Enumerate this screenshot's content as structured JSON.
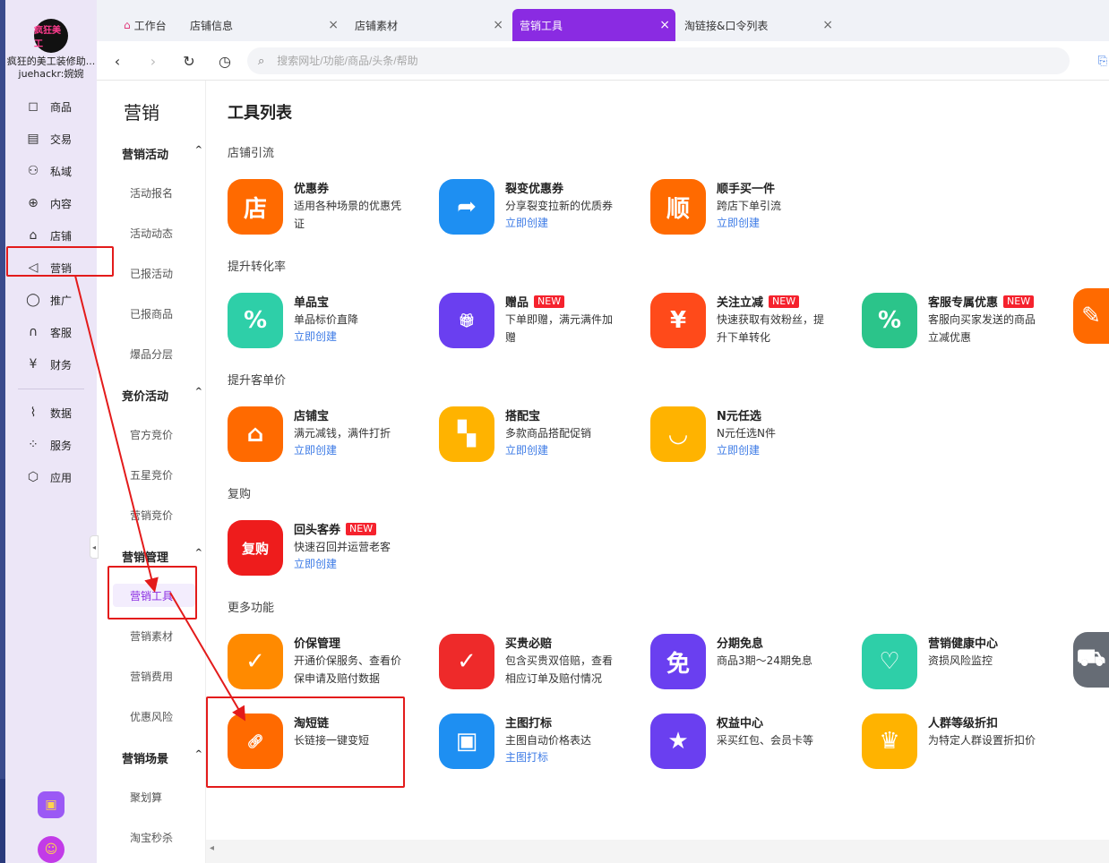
{
  "shop": {
    "logo_text": "疯狂美工",
    "name": "疯狂的美工装修助...",
    "user": "juehackr:婉婉"
  },
  "rail": [
    {
      "label": "商品",
      "icon": "goods-icon",
      "glyph": "◻"
    },
    {
      "label": "交易",
      "icon": "trade-icon",
      "glyph": "▤"
    },
    {
      "label": "私域",
      "icon": "private-domain-icon",
      "glyph": "⚇"
    },
    {
      "label": "内容",
      "icon": "content-icon",
      "glyph": "⊕"
    },
    {
      "label": "店铺",
      "icon": "store-icon",
      "glyph": "⌂"
    },
    {
      "label": "营销",
      "icon": "megaphone-icon",
      "glyph": "◁"
    },
    {
      "label": "推广",
      "icon": "bulb-icon",
      "glyph": "◯"
    },
    {
      "label": "客服",
      "icon": "headset-icon",
      "glyph": "∩"
    },
    {
      "label": "财务",
      "icon": "yuan-icon",
      "glyph": "¥"
    },
    {
      "label": "数据",
      "icon": "chart-icon",
      "glyph": "⌇"
    },
    {
      "label": "服务",
      "icon": "grid-icon",
      "glyph": "⁘"
    },
    {
      "label": "应用",
      "icon": "box-icon",
      "glyph": "⬡"
    }
  ],
  "tabs": [
    {
      "label": "工作台",
      "closable": false
    },
    {
      "label": "店铺信息",
      "closable": true
    },
    {
      "label": "店铺素材",
      "closable": true
    },
    {
      "label": "营销工具",
      "closable": true,
      "active": true
    },
    {
      "label": "淘链接&口令列表",
      "closable": true
    }
  ],
  "nav": {
    "back": "‹",
    "forward": "›",
    "refresh": "↻",
    "history": "◷",
    "search_placeholder": "搜索网址/功能/商品/头条/帮助"
  },
  "submenu": {
    "title": "营销",
    "groups": [
      {
        "title": "营销活动",
        "items": [
          "活动报名",
          "活动动态",
          "已报活动",
          "已报商品",
          "爆品分层"
        ]
      },
      {
        "title": "竞价活动",
        "items": [
          "官方竞价",
          "五星竞价",
          "营销竞价"
        ]
      },
      {
        "title": "营销管理",
        "items": [
          "营销工具",
          "营销素材",
          "营销费用",
          "优惠风险"
        ]
      },
      {
        "title": "营销场景",
        "items": [
          "聚划算",
          "淘宝秒杀"
        ]
      }
    ]
  },
  "main": {
    "title": "工具列表",
    "sections": [
      {
        "title": "店铺引流"
      },
      {
        "title": "提升转化率"
      },
      {
        "title": "提升客单价"
      },
      {
        "title": "复购"
      },
      {
        "title": "更多功能"
      }
    ],
    "tools": [
      {
        "name": "优惠券",
        "desc": "适用各种场景的优惠凭证",
        "link": "",
        "badge": "",
        "icon": "store-coupon-icon",
        "glyph": "店",
        "color": "#ff6a00"
      },
      {
        "name": "裂变优惠券",
        "desc": "分享裂变拉新的优质券",
        "link": "立即创建",
        "badge": "",
        "icon": "share-arrow-icon",
        "glyph": "➦",
        "color": "#1e8ff2"
      },
      {
        "name": "顺手买一件",
        "desc": "跨店下单引流",
        "link": "立即创建",
        "badge": "",
        "icon": "shun-icon",
        "glyph": "顺",
        "color": "#ff6a00"
      },
      {
        "name": "单品宝",
        "desc": "单品标价直降",
        "link": "立即创建",
        "badge": "",
        "icon": "percent-tag-icon",
        "glyph": "%",
        "color": "#2ecfa8"
      },
      {
        "name": "赠品",
        "desc": "下单即赠，满元满件加赠",
        "link": "",
        "badge": "NEW",
        "icon": "gift-icon",
        "glyph": "🎁︎",
        "color": "#6a3ff0"
      },
      {
        "name": "关注立减",
        "desc": "快速获取有效粉丝，提升下单转化",
        "link": "",
        "badge": "NEW",
        "icon": "red-envelope-icon",
        "glyph": "¥",
        "color": "#ff4a1a"
      },
      {
        "name": "客服专属优惠",
        "desc": "客服向买家发送的商品立减优惠",
        "link": "",
        "badge": "NEW",
        "icon": "discount-tag-icon",
        "glyph": "%",
        "color": "#2bc48a"
      },
      {
        "name": "店铺宝",
        "desc": "满元减钱，满件打折",
        "link": "立即创建",
        "badge": "",
        "icon": "shop-awning-icon",
        "glyph": "⌂",
        "color": "#ff6a00"
      },
      {
        "name": "搭配宝",
        "desc": "多款商品搭配促销",
        "link": "立即创建",
        "badge": "",
        "icon": "layout-grid-icon",
        "glyph": "▚",
        "color": "#ffb300"
      },
      {
        "name": "N元任选",
        "desc": "N元任选N件",
        "link": "立即创建",
        "badge": "",
        "icon": "shopping-bag-icon",
        "glyph": "◡",
        "color": "#ffb300"
      },
      {
        "name": "回头客券",
        "desc": "快速召回并运营老客",
        "link": "立即创建",
        "badge": "NEW",
        "icon": "repurchase-ticket-icon",
        "glyph": "复购",
        "color": "#ee1c1c"
      },
      {
        "name": "价保管理",
        "desc": "开通价保服务、查看价保申请及赔付数据",
        "link": "",
        "badge": "",
        "icon": "shield-check-icon",
        "glyph": "✓",
        "color": "#ff8a00"
      },
      {
        "name": "买贵必赔",
        "desc": "包含买贵双倍赔，查看相应订单及赔付情况",
        "link": "",
        "badge": "",
        "icon": "check-circle-icon",
        "glyph": "✓",
        "color": "#ee2a2a"
      },
      {
        "name": "分期免息",
        "desc": "商品3期～24期免息",
        "link": "",
        "badge": "",
        "icon": "interest-free-icon",
        "glyph": "免",
        "color": "#6a3ff0"
      },
      {
        "name": "营销健康中心",
        "desc": "资损风险监控",
        "link": "",
        "badge": "",
        "icon": "health-shield-icon",
        "glyph": "♡",
        "color": "#2ecfa8"
      },
      {
        "name": "淘短链",
        "desc": "长链接一键变短",
        "link": "",
        "badge": "",
        "icon": "link-icon",
        "glyph": "🔗︎",
        "color": "#ff6a00"
      },
      {
        "name": "主图打标",
        "desc": "主图自动价格表达",
        "link": "主图打标",
        "badge": "",
        "icon": "book-tag-icon",
        "glyph": "▣",
        "color": "#1e8ff2"
      },
      {
        "name": "权益中心",
        "desc": "采买红包、会员卡等",
        "link": "",
        "badge": "",
        "icon": "star-badge-icon",
        "glyph": "★",
        "color": "#6a3ff0"
      },
      {
        "name": "人群等级折扣",
        "desc": "为特定人群设置折扣价",
        "link": "",
        "badge": "",
        "icon": "crown-icon",
        "glyph": "♛",
        "color": "#ffb300"
      }
    ],
    "partial_tools": [
      {
        "icon": "edit-icon",
        "glyph": "✎",
        "color": "#ff6a00"
      },
      {
        "icon": "truck-icon",
        "glyph": "⛟",
        "color": "#666c75"
      }
    ]
  }
}
